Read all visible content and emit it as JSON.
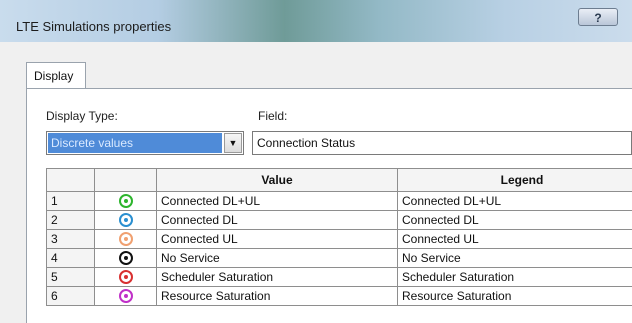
{
  "window": {
    "title": "LTE Simulations properties",
    "help_label": "?"
  },
  "tabs": [
    {
      "label": "Display"
    }
  ],
  "display_type": {
    "label": "Display Type:",
    "value": "Discrete values"
  },
  "field": {
    "label": "Field:",
    "value": "Connection Status"
  },
  "grid": {
    "headers": [
      "",
      "",
      "Value",
      "Legend"
    ],
    "rows": [
      {
        "num": "1",
        "icon": "connected-dl-ul-icon",
        "color": "#2db52d",
        "value": "Connected DL+UL",
        "legend": "Connected DL+UL"
      },
      {
        "num": "2",
        "icon": "connected-dl-icon",
        "color": "#2a8fd0",
        "value": "Connected DL",
        "legend": "Connected DL"
      },
      {
        "num": "3",
        "icon": "connected-ul-icon",
        "color": "#f0a070",
        "value": "Connected UL",
        "legend": "Connected UL"
      },
      {
        "num": "4",
        "icon": "no-service-icon",
        "color": "#111111",
        "value": "No Service",
        "legend": "No Service"
      },
      {
        "num": "5",
        "icon": "scheduler-saturation-icon",
        "color": "#d83030",
        "value": "Scheduler Saturation",
        "legend": "Scheduler Saturation"
      },
      {
        "num": "6",
        "icon": "resource-saturation-icon",
        "color": "#c030c8",
        "value": "Resource Saturation",
        "legend": "Resource Saturation"
      }
    ]
  }
}
